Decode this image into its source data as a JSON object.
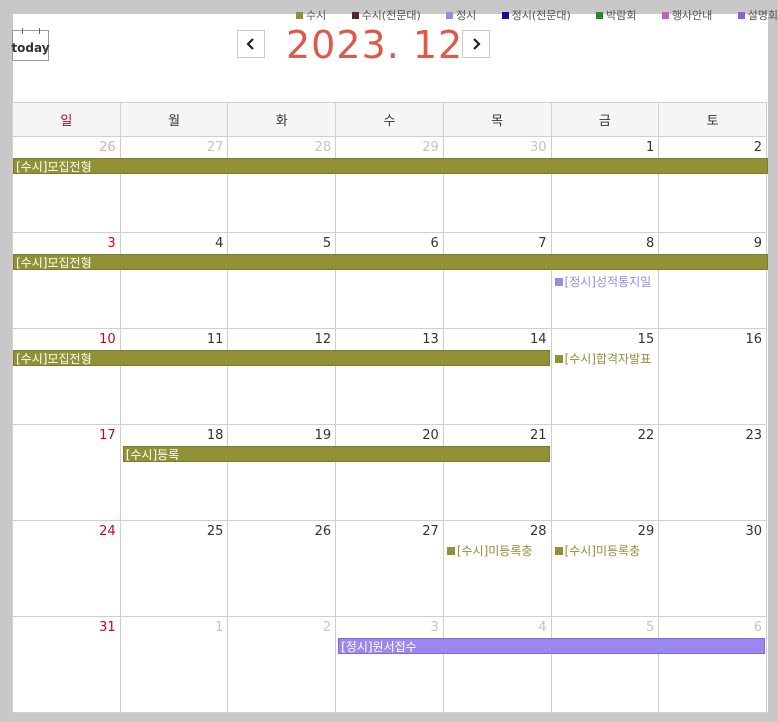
{
  "legend": [
    {
      "label": "수시",
      "color": "#919238"
    },
    {
      "label": "수시(전문대)",
      "color": "#4a2e22"
    },
    {
      "label": "정시",
      "color": "#8f8fe8"
    },
    {
      "label": "정시(전문대)",
      "color": "#1a0aa0"
    },
    {
      "label": "박람회",
      "color": "#2a8a2a"
    },
    {
      "label": "행사안내",
      "color": "#c060c0"
    },
    {
      "label": "설명회",
      "color": "#8a60e0"
    }
  ],
  "toolbar": {
    "today_label": "today",
    "prev_icon": "chevron-left-icon",
    "next_icon": "chevron-right-icon",
    "title": "2023. 12"
  },
  "weekdays": [
    "일",
    "월",
    "화",
    "수",
    "목",
    "금",
    "토"
  ],
  "weeks": [
    [
      "26",
      "27",
      "28",
      "29",
      "30",
      "1",
      "2"
    ],
    [
      "3",
      "4",
      "5",
      "6",
      "7",
      "8",
      "9"
    ],
    [
      "10",
      "11",
      "12",
      "13",
      "14",
      "15",
      "16"
    ],
    [
      "17",
      "18",
      "19",
      "20",
      "21",
      "22",
      "23"
    ],
    [
      "24",
      "25",
      "26",
      "27",
      "28",
      "29",
      "30"
    ],
    [
      "31",
      "1",
      "2",
      "3",
      "4",
      "5",
      "6"
    ]
  ],
  "events": {
    "w0_bar": "[수시]모집전형",
    "w1_bar": "[수시]모집전형",
    "w1_dot": "[정시]성적통지일",
    "w2_bar": "[수시]모집전형",
    "w2_dot": "[수시]합격자발표",
    "w3_bar": "[수시]등록",
    "w4_dot1": "[수시]미등록충",
    "w4_dot2": "[수시]미등록충",
    "w5_bar": "[정시]원서접수"
  },
  "colors": {
    "susi": "#919238",
    "jeongsi": "#9a88f0",
    "jeongsi_dot": "#8f8fe8",
    "accent_title": "#e0574b",
    "sunday": "#d0021b"
  }
}
